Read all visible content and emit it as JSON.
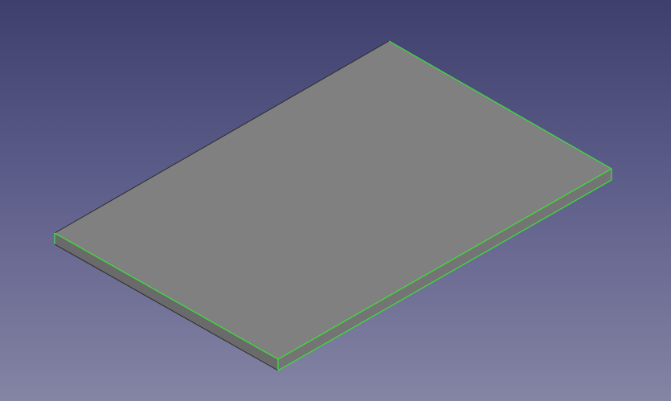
{
  "viewport": {
    "background_top": "#3f3f6d",
    "background_bottom": "#8484a4"
  },
  "plate": {
    "face_color": "#7f7f7f",
    "side_color_front": "#6b6b6b",
    "side_color_right": "#737373",
    "edge_color": "#2a2a2a",
    "highlight_color": "#38e538"
  }
}
